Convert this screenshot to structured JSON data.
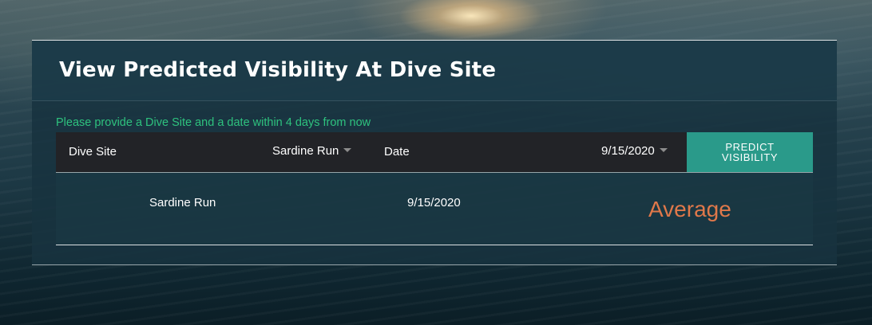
{
  "header": {
    "title": "View Predicted Visibility At Dive Site"
  },
  "form": {
    "hint": "Please provide a Dive Site and a date within 4 days from now",
    "dive_site_label": "Dive Site",
    "dive_site_value": "Sardine Run",
    "date_label": "Date",
    "date_value": "9/15/2020",
    "predict_button_line1": "PREDICT",
    "predict_button_line2": "VISIBILITY"
  },
  "result": {
    "site": "Sardine Run",
    "date": "9/15/2020",
    "visibility": "Average"
  },
  "colors": {
    "hint_text": "#2ec27e",
    "button_bg": "#2a9a8a",
    "visibility_text": "#e0784a",
    "form_bar_bg": "#222327"
  }
}
